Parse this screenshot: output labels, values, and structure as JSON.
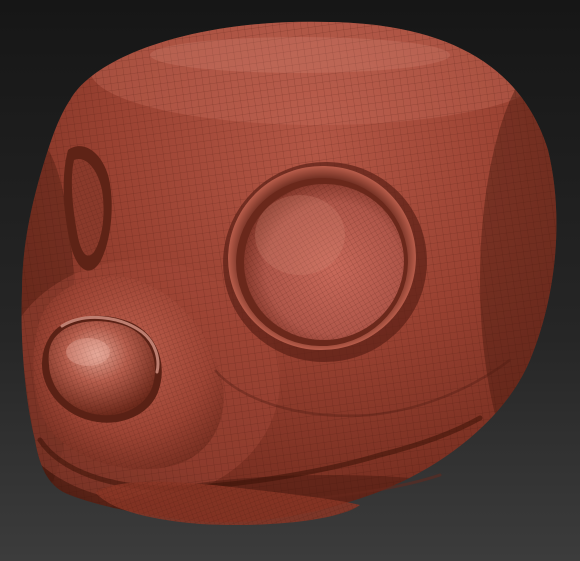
{
  "viewport": {
    "subject": "sculpted-animal-head",
    "material": "red-wax-clay",
    "wireframe": true
  },
  "colors": {
    "background_top": "#1a1a1a",
    "background_bottom": "#3a3a3a",
    "clay_dark": "#5a2416",
    "clay_mid": "#9a4231",
    "clay_light": "#c56654",
    "clay_highlight": "#e39a88",
    "wire": "#3a1208"
  }
}
